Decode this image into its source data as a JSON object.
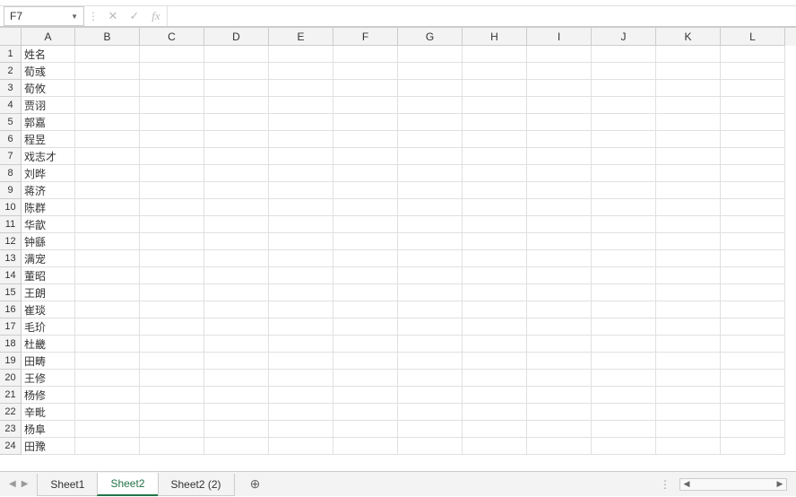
{
  "formula_bar": {
    "name_box": "F7",
    "cancel_symbol": "✕",
    "confirm_symbol": "✓",
    "fx_symbol": "fx",
    "value": ""
  },
  "columns": [
    "A",
    "B",
    "C",
    "D",
    "E",
    "F",
    "G",
    "H",
    "I",
    "J",
    "K",
    "L"
  ],
  "row_numbers": [
    1,
    2,
    3,
    4,
    5,
    6,
    7,
    8,
    9,
    10,
    11,
    12,
    13,
    14,
    15,
    16,
    17,
    18,
    19,
    20,
    21,
    22,
    23,
    24
  ],
  "col_a_values": [
    "姓名",
    "荀彧",
    "荀攸",
    "贾诩",
    "郭嘉",
    "程昱",
    "戏志才",
    "刘晔",
    "蒋济",
    "陈群",
    "华歆",
    "钟繇",
    "满宠",
    "董昭",
    "王朗",
    "崔琰",
    "毛玠",
    "杜畿",
    "田畴",
    "王修",
    "杨修",
    "辛毗",
    "杨阜",
    "田豫"
  ],
  "sheet_tabs": {
    "items": [
      {
        "label": "Sheet1",
        "active": false
      },
      {
        "label": "Sheet2",
        "active": true
      },
      {
        "label": "Sheet2 (2)",
        "active": false
      }
    ],
    "add_symbol": "⊕"
  },
  "nav": {
    "prev": "◀",
    "next": "▶",
    "dots": "⋮",
    "scroll_left": "◀",
    "scroll_right": "▶"
  }
}
